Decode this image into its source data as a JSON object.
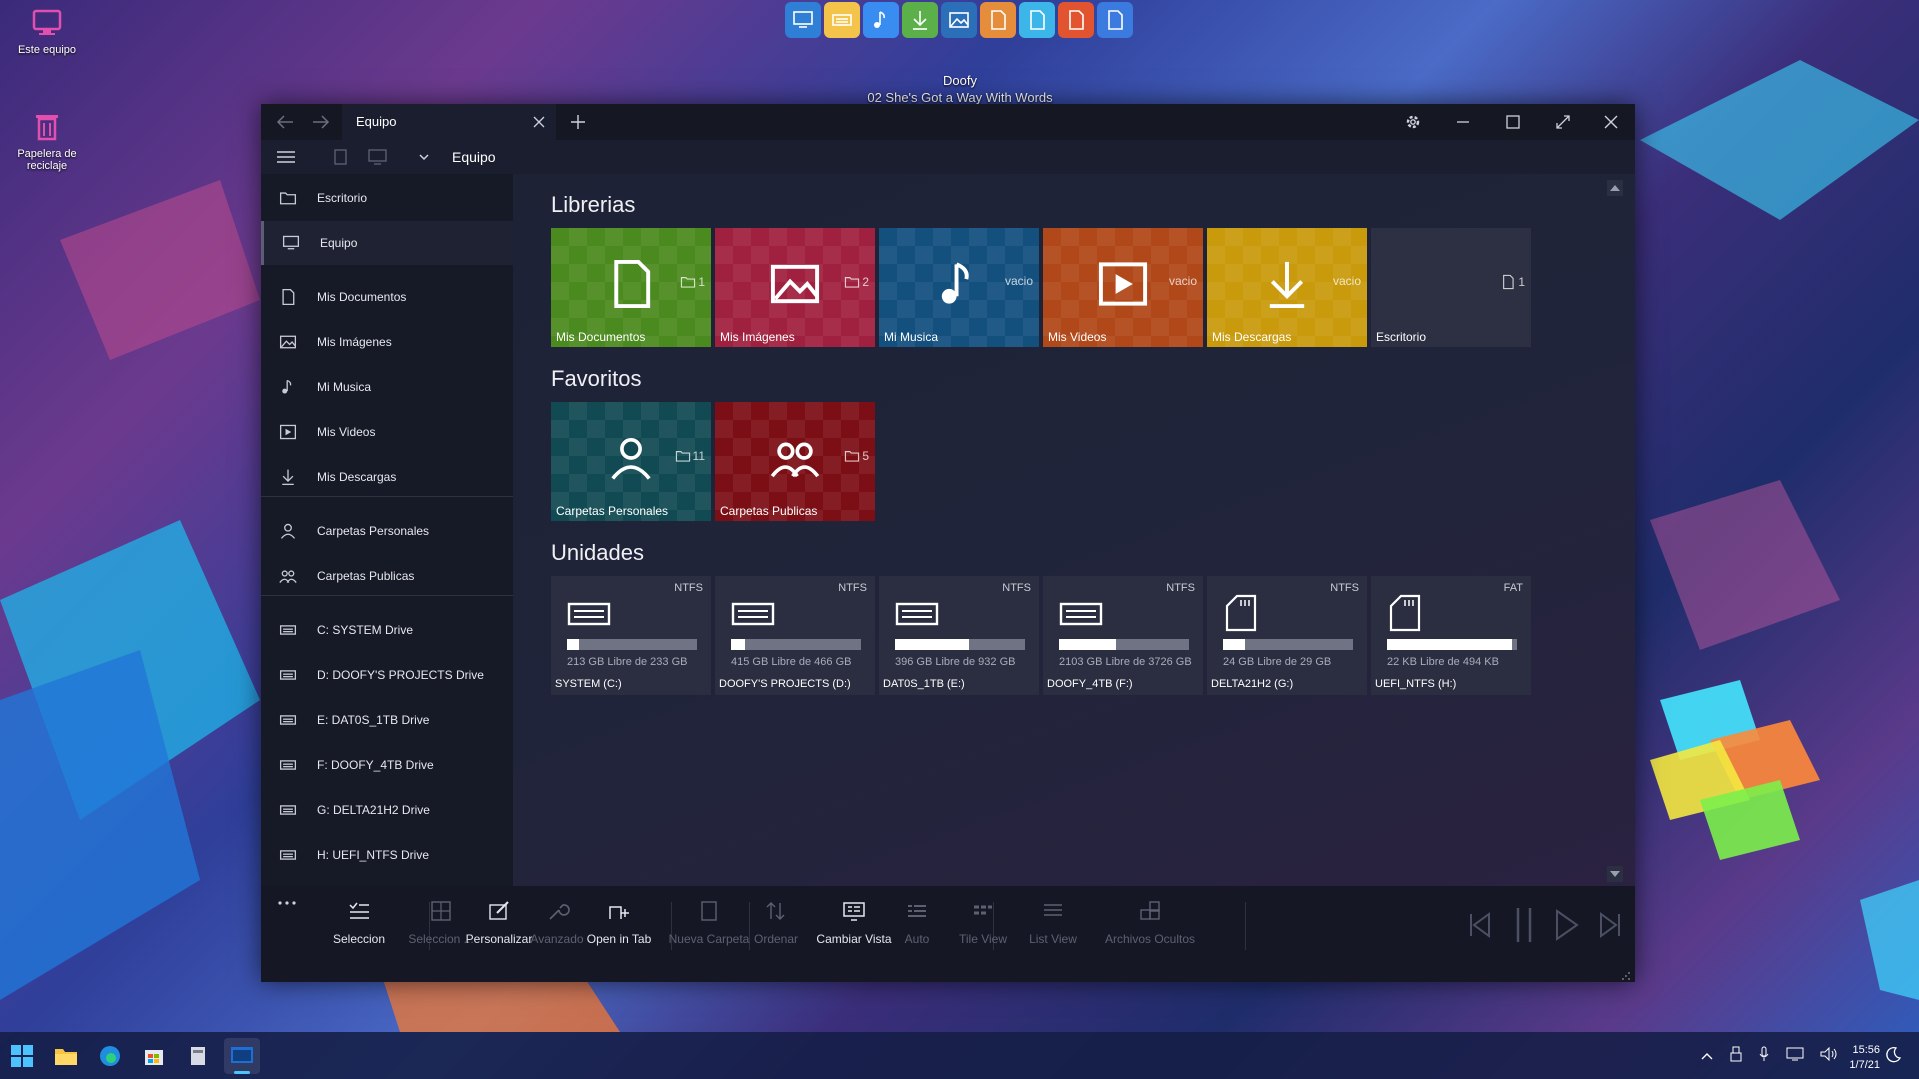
{
  "desktop": {
    "icons": [
      {
        "label": "Este equipo"
      },
      {
        "label": "Papelera de reciclaje"
      }
    ]
  },
  "dock": {
    "items": [
      {
        "icon": "monitor-icon",
        "color": "#2f7fd6"
      },
      {
        "icon": "drive-icon",
        "color": "#f3c34a"
      },
      {
        "icon": "music-note-icon",
        "color": "#3a8df0"
      },
      {
        "icon": "download-icon",
        "color": "#5bb04a"
      },
      {
        "icon": "camera-icon",
        "color": "#2a6fb8"
      },
      {
        "icon": "calendar-icon",
        "color": "#e58d3a"
      },
      {
        "icon": "recycle-icon",
        "color": "#3cb6e8"
      },
      {
        "icon": "rocket-icon",
        "color": "#e2542f"
      },
      {
        "icon": "settings-icon",
        "color": "#3b7be0"
      }
    ]
  },
  "now_playing": {
    "artist": "Doofy",
    "track": "02 She's Got a Way With Words"
  },
  "window": {
    "tab_title": "Equipo",
    "address": "Equipo",
    "sidebar": {
      "items": [
        {
          "label": "Escritorio",
          "icon": "folder-icon"
        },
        {
          "label": "Equipo",
          "icon": "monitor-icon"
        },
        {
          "label": "Mis Documentos",
          "icon": "document-icon"
        },
        {
          "label": "Mis Imágenes",
          "icon": "image-icon"
        },
        {
          "label": "Mi Musica",
          "icon": "music-note-icon"
        },
        {
          "label": "Mis Videos",
          "icon": "play-icon"
        },
        {
          "label": "Mis Descargas",
          "icon": "download-icon"
        },
        {
          "label": "Carpetas Personales",
          "icon": "person-icon"
        },
        {
          "label": "Carpetas Publicas",
          "icon": "people-icon"
        },
        {
          "label": "C: SYSTEM Drive",
          "icon": "drive-icon"
        },
        {
          "label": "D: DOOFY'S PROJECTS Drive",
          "icon": "drive-icon"
        },
        {
          "label": "E: DAT0S_1TB Drive",
          "icon": "drive-icon"
        },
        {
          "label": "F: DOOFY_4TB Drive",
          "icon": "drive-icon"
        },
        {
          "label": "G: DELTA21H2 Drive",
          "icon": "drive-icon"
        },
        {
          "label": "H: UEFI_NTFS Drive",
          "icon": "drive-icon"
        }
      ]
    },
    "sections": {
      "libraries": "Librerias",
      "favorites": "Favoritos",
      "drives": "Unidades"
    },
    "libraries": [
      {
        "label": "Mis Documentos",
        "count": "1",
        "color": "#4b8a1f",
        "icon": "document-icon",
        "count_icon": "folder-icon"
      },
      {
        "label": "Mis Imágenes",
        "count": "2",
        "color": "#a0213f",
        "icon": "image-icon",
        "count_icon": "folder-icon"
      },
      {
        "label": "Mi Musica",
        "count": "vacio",
        "color": "#13507e",
        "icon": "music-note-icon",
        "count_icon": ""
      },
      {
        "label": "Mis Videos",
        "count": "vacio",
        "color": "#b0481a",
        "icon": "play-icon",
        "count_icon": ""
      },
      {
        "label": "Mis Descargas",
        "count": "vacio",
        "color": "#c99a0c",
        "icon": "download-icon",
        "count_icon": ""
      },
      {
        "label": "Escritorio",
        "count": "1",
        "color": "#2c3042",
        "icon": "",
        "count_icon": "document-icon"
      }
    ],
    "favorites": [
      {
        "label": "Carpetas Personales",
        "count": "11",
        "color": "#124a54",
        "icon": "person-icon"
      },
      {
        "label": "Carpetas Publicas",
        "count": "5",
        "color": "#7c0f16",
        "icon": "people-icon"
      }
    ],
    "drives": [
      {
        "name": "SYSTEM (C:)",
        "fs": "NTFS",
        "free": "213 GB Libre de 233 GB",
        "used_fraction": 0.09,
        "type": "drive"
      },
      {
        "name": "DOOFY'S PROJECTS (D:)",
        "fs": "NTFS",
        "free": "415 GB Libre de 466 GB",
        "used_fraction": 0.11,
        "type": "drive"
      },
      {
        "name": "DAT0S_1TB (E:)",
        "fs": "NTFS",
        "free": "396 GB Libre de 932 GB",
        "used_fraction": 0.57,
        "type": "drive"
      },
      {
        "name": "DOOFY_4TB (F:)",
        "fs": "NTFS",
        "free": "2103 GB Libre de 3726 GB",
        "used_fraction": 0.44,
        "type": "drive"
      },
      {
        "name": "DELTA21H2 (G:)",
        "fs": "NTFS",
        "free": "24 GB Libre de 29 GB",
        "used_fraction": 0.17,
        "type": "sd"
      },
      {
        "name": "UEFI_NTFS (H:)",
        "fs": "FAT",
        "free": "22 KB Libre de 494 KB",
        "used_fraction": 0.96,
        "type": "sd"
      }
    ],
    "bottom_toolbar": [
      {
        "label": "Seleccion",
        "icon": "checklist-icon",
        "enabled": true
      },
      {
        "label": "Seleccion ...",
        "icon": "grid-select-icon",
        "enabled": false
      },
      {
        "label": "Personalizar",
        "icon": "edit-icon",
        "enabled": true
      },
      {
        "label": "Avanzado",
        "icon": "wrench-icon",
        "enabled": false
      },
      {
        "label": "Open in Tab",
        "icon": "new-tab-icon",
        "enabled": true
      },
      {
        "label": "Nueva Carpeta",
        "icon": "new-folder-icon",
        "enabled": false
      },
      {
        "label": "Ordenar",
        "icon": "sort-icon",
        "enabled": false
      },
      {
        "label": "Cambiar Vista",
        "icon": "change-view-icon",
        "enabled": true
      },
      {
        "label": "Auto",
        "icon": "auto-view-icon",
        "enabled": false
      },
      {
        "label": "Tile View",
        "icon": "tile-view-icon",
        "enabled": false
      },
      {
        "label": "List View",
        "icon": "list-view-icon",
        "enabled": false
      },
      {
        "label": "Archivos Ocultos",
        "icon": "hidden-files-icon",
        "enabled": false
      }
    ]
  },
  "taskbar": {
    "time": "15:56",
    "date": "1/7/21"
  }
}
